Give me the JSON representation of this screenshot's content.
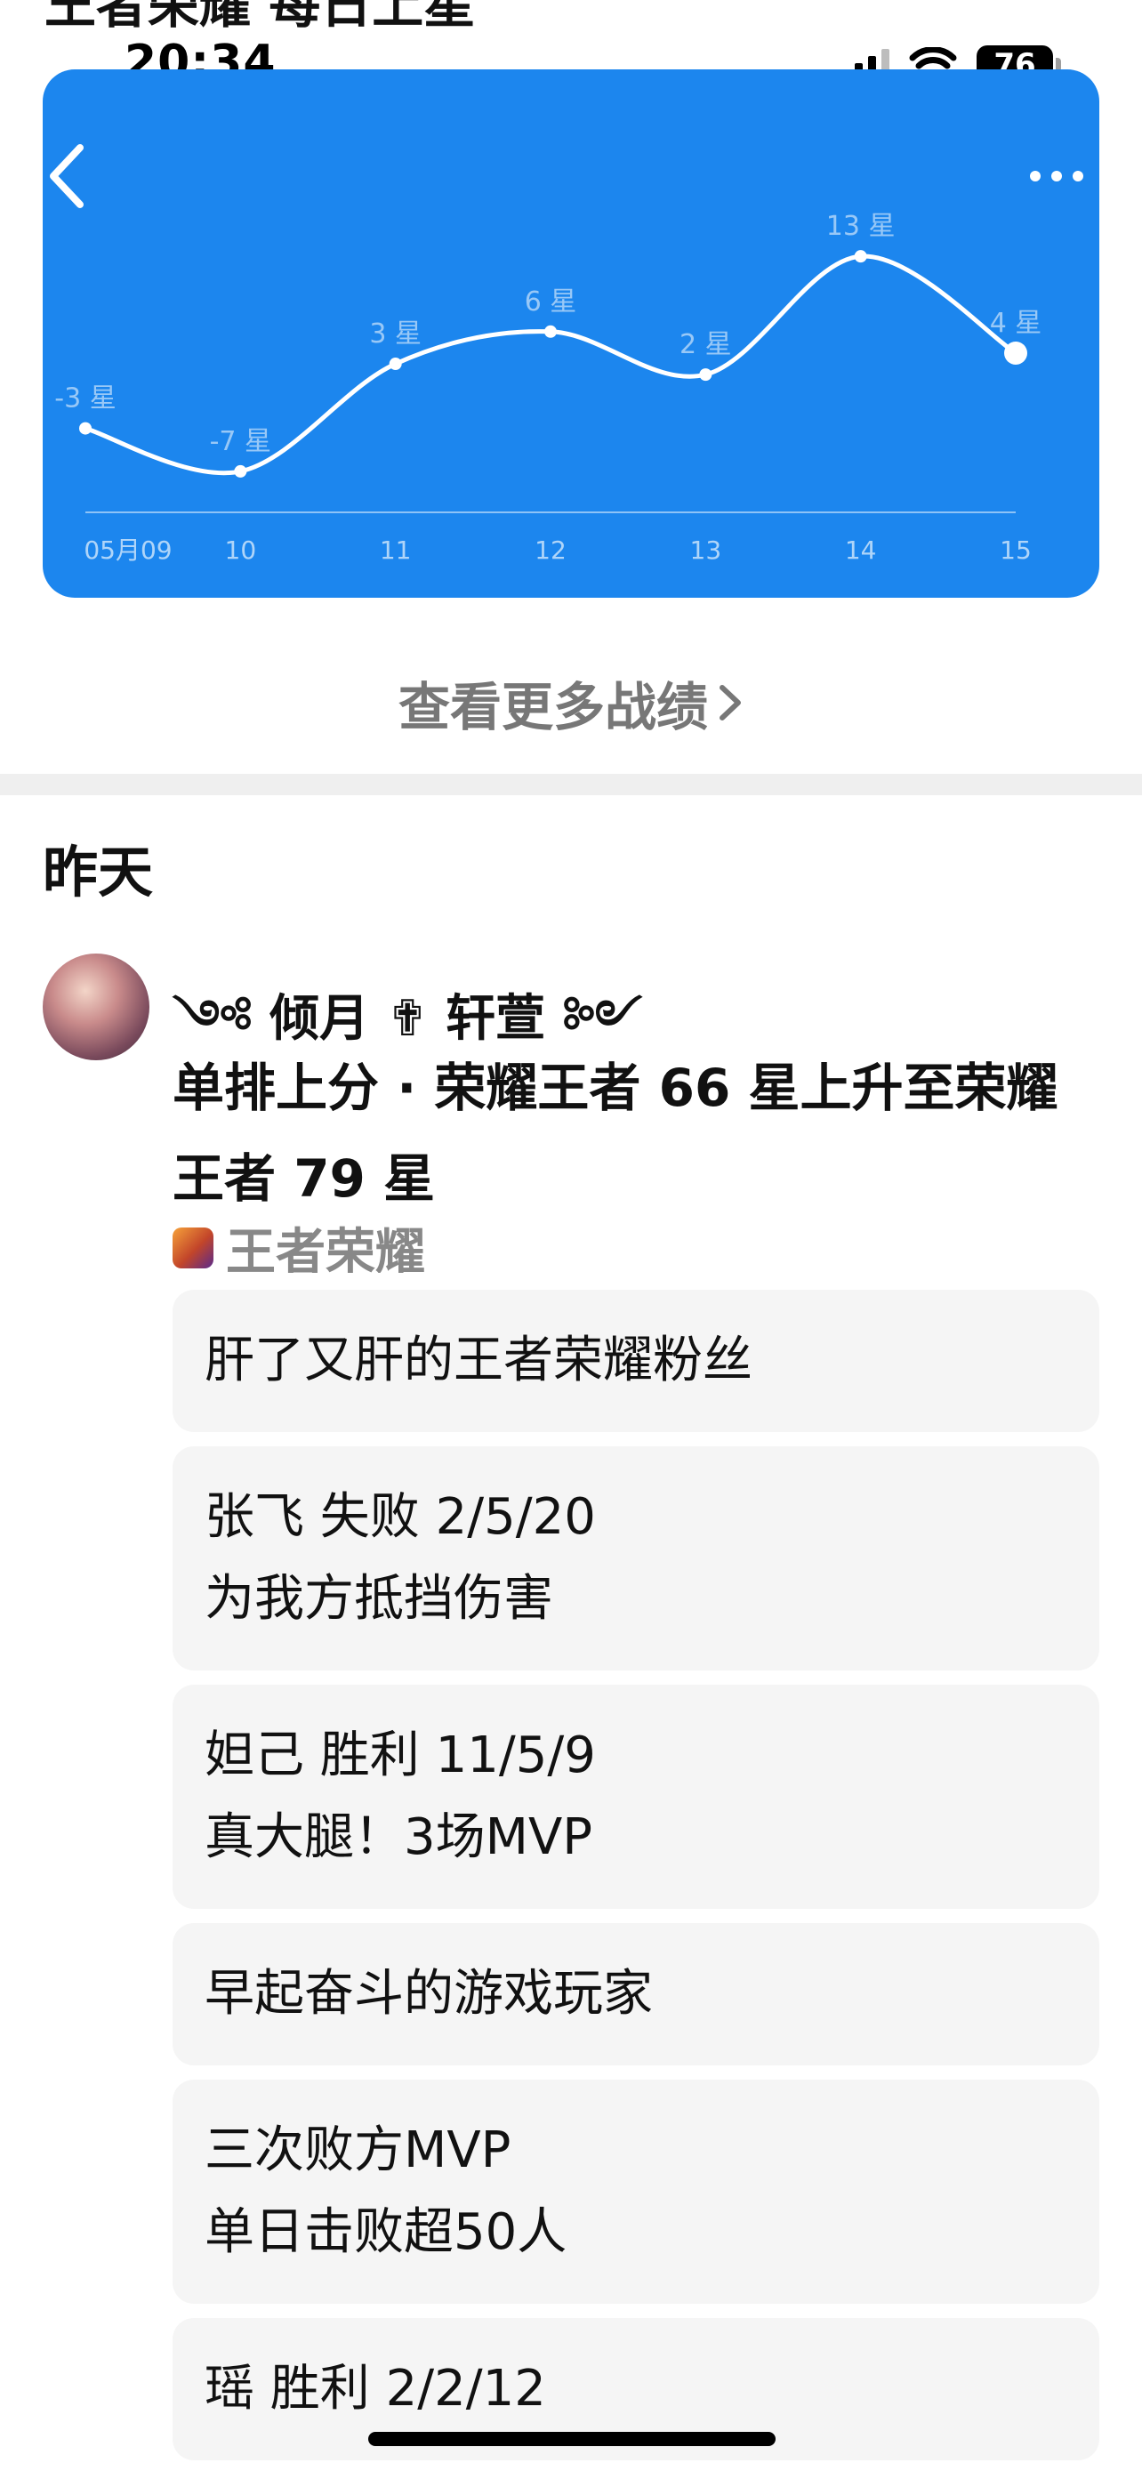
{
  "top_heading": "王者荣耀 每日上星",
  "status_bar": {
    "time": "20:34",
    "battery": "76"
  },
  "chart_data": {
    "type": "line",
    "x": [
      "05月09",
      "10",
      "11",
      "12",
      "13",
      "14",
      "15"
    ],
    "values": [
      -3,
      -7,
      3,
      6,
      2,
      13,
      4
    ],
    "point_labels": [
      "-3 星",
      "-7 星",
      "3 星",
      "6 星",
      "2 星",
      "13 星",
      "4 星"
    ],
    "ylim": [
      -8,
      15
    ],
    "grid": false
  },
  "more_link": "查看更多战绩",
  "section_title": "昨天",
  "post": {
    "username": "༺ 倾月 ✟ 轩萱 ༻",
    "headline": "单排上分 · 荣耀王者 66 星上升至荣耀王者 79 星",
    "game": "王者荣耀",
    "cards": [
      {
        "lines": [
          "肝了又肝的王者荣耀粉丝"
        ]
      },
      {
        "lines": [
          "张飞 失败 2/5/20",
          "为我方抵挡伤害"
        ]
      },
      {
        "lines": [
          "妲己 胜利 11/5/9",
          "真大腿！3场MVP"
        ]
      },
      {
        "lines": [
          "早起奋斗的游戏玩家"
        ]
      },
      {
        "lines": [
          "三次败方MVP",
          "单日击败超50人"
        ]
      },
      {
        "lines": [
          "瑶 胜利 2/2/12"
        ]
      }
    ]
  }
}
